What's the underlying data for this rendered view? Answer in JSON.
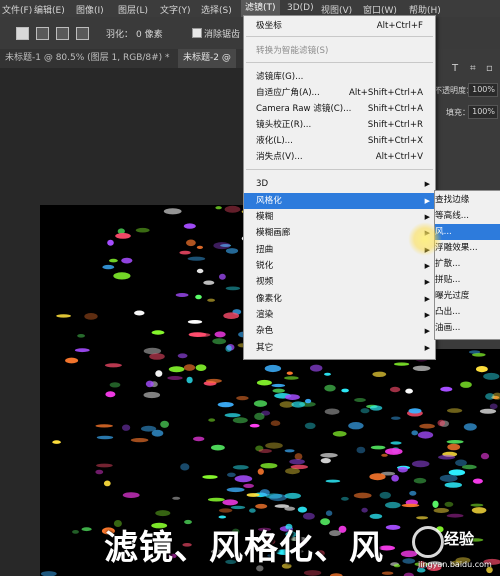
{
  "menubar": {
    "items": [
      "文件(F)",
      "编辑(E)",
      "图像(I)",
      "图层(L)",
      "文字(Y)",
      "选择(S)",
      "滤镜(T)",
      "3D(D)",
      "视图(V)",
      "窗口(W)",
      "帮助(H)"
    ],
    "active_index": 6
  },
  "options": {
    "feather_label": "羽化：",
    "feather_value": "0 像素",
    "antialias_label": "消除锯齿"
  },
  "tabs": [
    {
      "label": "未标题-1 @ 80.5% (图层 1, RGB/8#) *",
      "active": false
    },
    {
      "label": "未标题-2 @",
      "active": true
    }
  ],
  "right_panel": {
    "opacity_label": "不透明度：",
    "opacity_value": "100%",
    "fill_label": "填充：",
    "fill_value": "100%"
  },
  "filter_menu": {
    "items": [
      {
        "label": "极坐标",
        "shortcut": "Alt+Ctrl+F"
      },
      {
        "label": "转换为智能滤镜(S)",
        "shortcut": ""
      },
      {
        "label": "滤镜库(G)...",
        "shortcut": ""
      },
      {
        "label": "自适应广角(A)...",
        "shortcut": "Alt+Shift+Ctrl+A"
      },
      {
        "label": "Camera Raw 滤镜(C)...",
        "shortcut": "Shift+Ctrl+A"
      },
      {
        "label": "镜头校正(R)...",
        "shortcut": "Shift+Ctrl+R"
      },
      {
        "label": "液化(L)...",
        "shortcut": "Shift+Ctrl+X"
      },
      {
        "label": "消失点(V)...",
        "shortcut": "Alt+Ctrl+V"
      },
      {
        "label": "3D",
        "shortcut": ""
      },
      {
        "label": "风格化",
        "shortcut": ""
      },
      {
        "label": "模糊",
        "shortcut": ""
      },
      {
        "label": "模糊画廊",
        "shortcut": ""
      },
      {
        "label": "扭曲",
        "shortcut": ""
      },
      {
        "label": "锐化",
        "shortcut": ""
      },
      {
        "label": "视频",
        "shortcut": ""
      },
      {
        "label": "像素化",
        "shortcut": ""
      },
      {
        "label": "渲染",
        "shortcut": ""
      },
      {
        "label": "杂色",
        "shortcut": ""
      },
      {
        "label": "其它",
        "shortcut": ""
      }
    ],
    "highlighted_index": 9
  },
  "stylize_submenu": {
    "items": [
      "查找边缘",
      "等高线...",
      "风...",
      "浮雕效果...",
      "扩散...",
      "拼贴...",
      "曝光过度",
      "凸出...",
      "油画..."
    ],
    "highlighted_index": 2
  },
  "caption": "滤镜、风格化、风",
  "watermark": {
    "brand": "经验",
    "url": "jingyan.baidu.com"
  },
  "colors": {
    "menu_highlight": "#2d7bdc",
    "menubar_bg": "#3c3c3c",
    "menu_bg": "#f0f0f0"
  }
}
